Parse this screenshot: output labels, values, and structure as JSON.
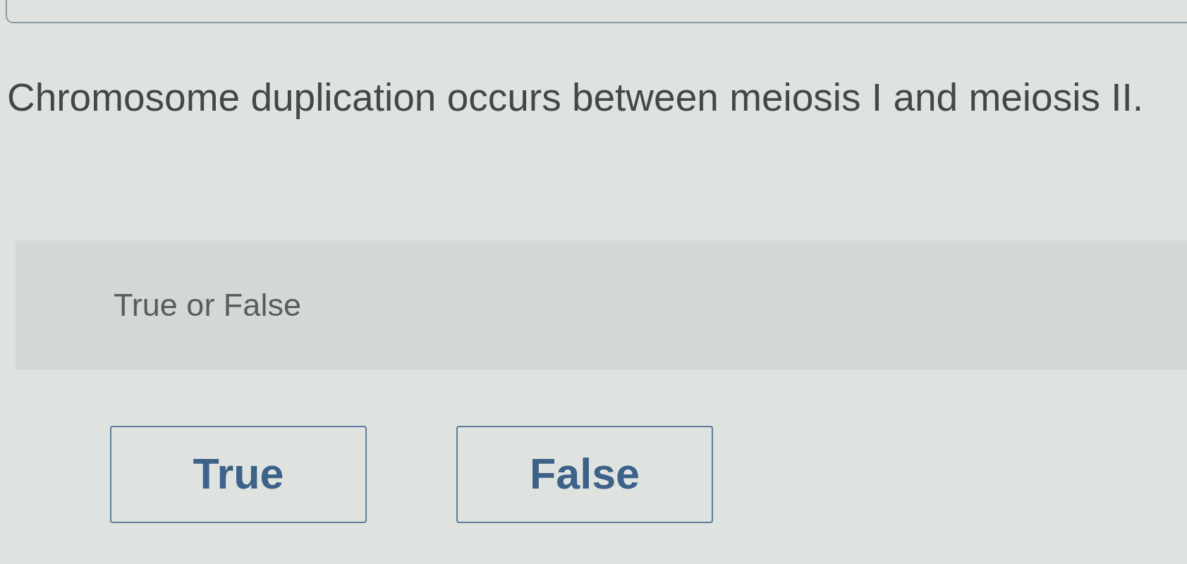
{
  "question": {
    "text": "Chromosome duplication occurs between meiosis I and meiosis II."
  },
  "prompt": {
    "text": "True or False"
  },
  "options": [
    {
      "label": "True",
      "selected": false
    },
    {
      "label": "False",
      "selected": false
    }
  ]
}
